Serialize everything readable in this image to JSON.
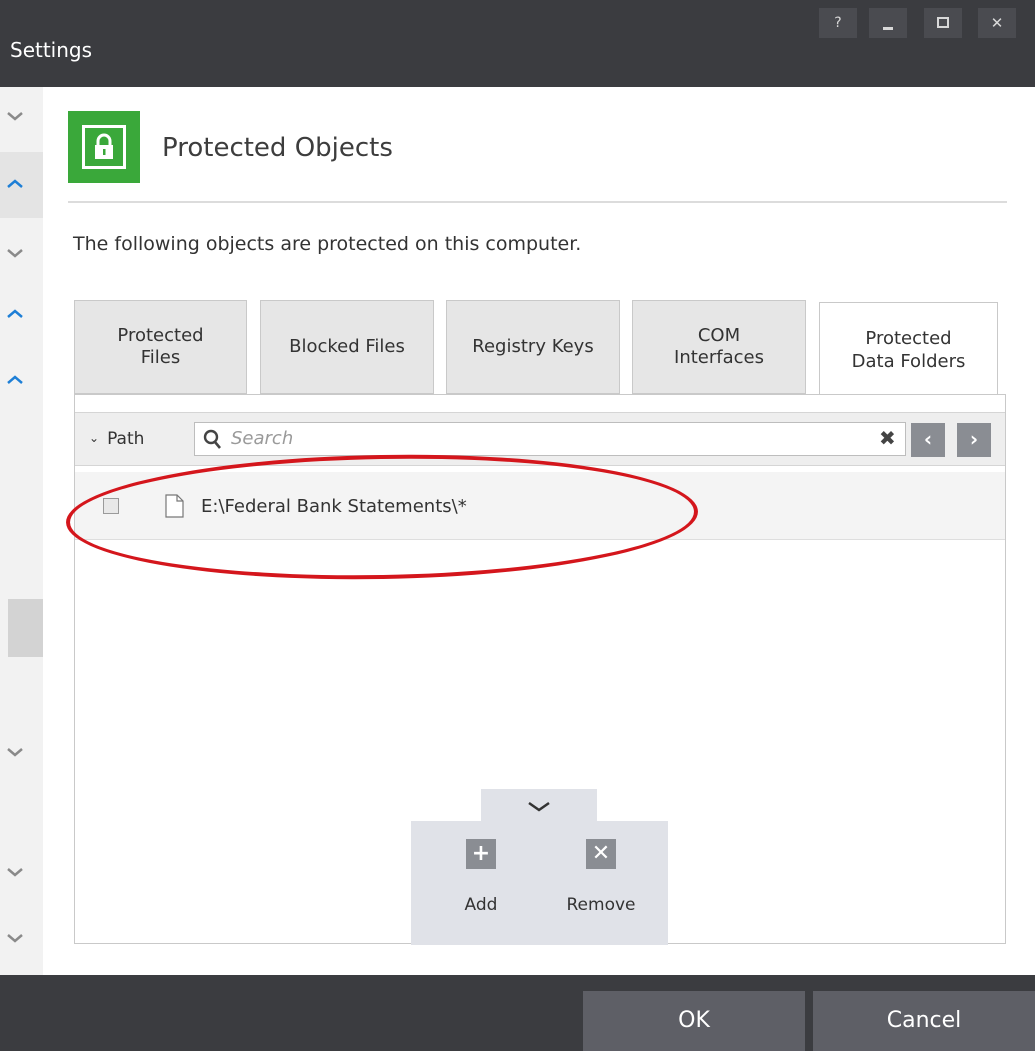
{
  "window": {
    "title": "Settings",
    "help_label": "?"
  },
  "header": {
    "title": "Protected Objects",
    "description": "The following objects are protected on this computer."
  },
  "tabs": [
    {
      "line1": "Protected",
      "line2": "Files"
    },
    {
      "line1": "Blocked Files",
      "line2": ""
    },
    {
      "line1": "Registry Keys",
      "line2": ""
    },
    {
      "line1": "COM",
      "line2": "Interfaces"
    },
    {
      "line1": "Protected",
      "line2": "Data Folders"
    }
  ],
  "active_tab": "Protected Data Folders",
  "table": {
    "column_header": "Path",
    "search_placeholder": "Search",
    "rows": [
      {
        "path": "E:\\Federal Bank Statements\\*",
        "checked": false
      }
    ]
  },
  "actions": {
    "add_label": "Add",
    "remove_label": "Remove"
  },
  "footer": {
    "ok_label": "OK",
    "cancel_label": "Cancel"
  },
  "colors": {
    "titlebar": "#3b3c40",
    "accent_green": "#3aa83a",
    "chevron_blue": "#1e7fd6",
    "annotation_red": "#d4161c"
  },
  "icons": [
    "lock-icon",
    "search-icon",
    "clear-icon",
    "file-icon",
    "plus-icon",
    "close-x-icon",
    "chevron-down-icon",
    "chevron-up-icon"
  ]
}
